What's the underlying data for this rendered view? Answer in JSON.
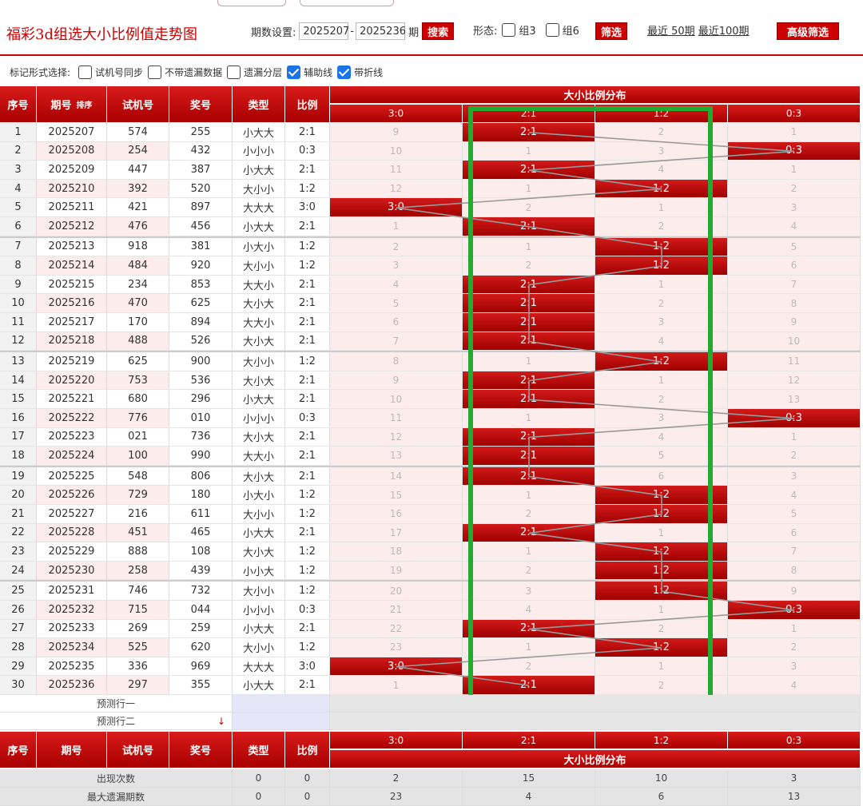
{
  "title": "福彩3d组选大小比例值走势图",
  "controls": {
    "period_label": "期数设置:",
    "from_period": "2025207",
    "dash": "-",
    "to_period": "2025236",
    "period_unit": "期",
    "search_label": "搜索",
    "shape_label": "形态:",
    "group3_label": "组3",
    "group6_label": "组6",
    "filter_label": "筛选",
    "recent50_label": "最近 50期",
    "recent100_label": "最近100期",
    "advanced_label": "高级筛选"
  },
  "markbar": {
    "label": "标记形式选择:",
    "opt1": "试机号同步",
    "opt2": "不带遗漏数据",
    "opt3": "遗漏分层",
    "opt4": "辅助线",
    "opt5": "带折线"
  },
  "headers": {
    "seq": "序号",
    "period": "期号",
    "sort": "排序",
    "trial": "试机号",
    "prize": "奖号",
    "type": "类型",
    "ratio": "比例",
    "dist": "大小比例分布",
    "cols": [
      "3:0",
      "2:1",
      "1:2",
      "0:3"
    ]
  },
  "rows": [
    {
      "seq": "1",
      "period": "2025207",
      "trial": "574",
      "prize": "255",
      "type": "小大大",
      "ratio": "2:1",
      "cells": [
        "9",
        "2:1",
        "2",
        "1"
      ],
      "hit": 1
    },
    {
      "seq": "2",
      "period": "2025208",
      "trial": "254",
      "prize": "432",
      "type": "小小小",
      "ratio": "0:3",
      "cells": [
        "10",
        "1",
        "3",
        "0:3"
      ],
      "hit": 3
    },
    {
      "seq": "3",
      "period": "2025209",
      "trial": "447",
      "prize": "387",
      "type": "小大大",
      "ratio": "2:1",
      "cells": [
        "11",
        "2:1",
        "4",
        "1"
      ],
      "hit": 1
    },
    {
      "seq": "4",
      "period": "2025210",
      "trial": "392",
      "prize": "520",
      "type": "大小小",
      "ratio": "1:2",
      "cells": [
        "12",
        "1",
        "1:2",
        "2"
      ],
      "hit": 2
    },
    {
      "seq": "5",
      "period": "2025211",
      "trial": "421",
      "prize": "897",
      "type": "大大大",
      "ratio": "3:0",
      "cells": [
        "3:0",
        "2",
        "1",
        "3"
      ],
      "hit": 0
    },
    {
      "seq": "6",
      "period": "2025212",
      "trial": "476",
      "prize": "456",
      "type": "小大大",
      "ratio": "2:1",
      "cells": [
        "1",
        "2:1",
        "2",
        "4"
      ],
      "hit": 1
    },
    {
      "seq": "7",
      "period": "2025213",
      "trial": "918",
      "prize": "381",
      "type": "小大小",
      "ratio": "1:2",
      "cells": [
        "2",
        "1",
        "1:2",
        "5"
      ],
      "hit": 2
    },
    {
      "seq": "8",
      "period": "2025214",
      "trial": "484",
      "prize": "920",
      "type": "大小小",
      "ratio": "1:2",
      "cells": [
        "3",
        "2",
        "1:2",
        "6"
      ],
      "hit": 2
    },
    {
      "seq": "9",
      "period": "2025215",
      "trial": "234",
      "prize": "853",
      "type": "大大小",
      "ratio": "2:1",
      "cells": [
        "4",
        "2:1",
        "1",
        "7"
      ],
      "hit": 1
    },
    {
      "seq": "10",
      "period": "2025216",
      "trial": "470",
      "prize": "625",
      "type": "大小大",
      "ratio": "2:1",
      "cells": [
        "5",
        "2:1",
        "2",
        "8"
      ],
      "hit": 1
    },
    {
      "seq": "11",
      "period": "2025217",
      "trial": "170",
      "prize": "894",
      "type": "大大小",
      "ratio": "2:1",
      "cells": [
        "6",
        "2:1",
        "3",
        "9"
      ],
      "hit": 1
    },
    {
      "seq": "12",
      "period": "2025218",
      "trial": "488",
      "prize": "526",
      "type": "大小大",
      "ratio": "2:1",
      "cells": [
        "7",
        "2:1",
        "4",
        "10"
      ],
      "hit": 1
    },
    {
      "seq": "13",
      "period": "2025219",
      "trial": "625",
      "prize": "900",
      "type": "大小小",
      "ratio": "1:2",
      "cells": [
        "8",
        "1",
        "1:2",
        "11"
      ],
      "hit": 2
    },
    {
      "seq": "14",
      "period": "2025220",
      "trial": "753",
      "prize": "536",
      "type": "大小大",
      "ratio": "2:1",
      "cells": [
        "9",
        "2:1",
        "1",
        "12"
      ],
      "hit": 1
    },
    {
      "seq": "15",
      "period": "2025221",
      "trial": "680",
      "prize": "296",
      "type": "小大大",
      "ratio": "2:1",
      "cells": [
        "10",
        "2:1",
        "2",
        "13"
      ],
      "hit": 1
    },
    {
      "seq": "16",
      "period": "2025222",
      "trial": "776",
      "prize": "010",
      "type": "小小小",
      "ratio": "0:3",
      "cells": [
        "11",
        "1",
        "3",
        "0:3"
      ],
      "hit": 3
    },
    {
      "seq": "17",
      "period": "2025223",
      "trial": "021",
      "prize": "736",
      "type": "大小大",
      "ratio": "2:1",
      "cells": [
        "12",
        "2:1",
        "4",
        "1"
      ],
      "hit": 1
    },
    {
      "seq": "18",
      "period": "2025224",
      "trial": "100",
      "prize": "990",
      "type": "大大小",
      "ratio": "2:1",
      "cells": [
        "13",
        "2:1",
        "5",
        "2"
      ],
      "hit": 1
    },
    {
      "seq": "19",
      "period": "2025225",
      "trial": "548",
      "prize": "806",
      "type": "大小大",
      "ratio": "2:1",
      "cells": [
        "14",
        "2:1",
        "6",
        "3"
      ],
      "hit": 1
    },
    {
      "seq": "20",
      "period": "2025226",
      "trial": "729",
      "prize": "180",
      "type": "小大小",
      "ratio": "1:2",
      "cells": [
        "15",
        "1",
        "1:2",
        "4"
      ],
      "hit": 2
    },
    {
      "seq": "21",
      "period": "2025227",
      "trial": "216",
      "prize": "611",
      "type": "大小小",
      "ratio": "1:2",
      "cells": [
        "16",
        "2",
        "1:2",
        "5"
      ],
      "hit": 2
    },
    {
      "seq": "22",
      "period": "2025228",
      "trial": "451",
      "prize": "465",
      "type": "小大大",
      "ratio": "2:1",
      "cells": [
        "17",
        "2:1",
        "1",
        "6"
      ],
      "hit": 1
    },
    {
      "seq": "23",
      "period": "2025229",
      "trial": "888",
      "prize": "108",
      "type": "大小大",
      "ratio": "1:2",
      "cells": [
        "18",
        "1",
        "1:2",
        "7"
      ],
      "hit": 2
    },
    {
      "seq": "24",
      "period": "2025230",
      "trial": "258",
      "prize": "439",
      "type": "小小大",
      "ratio": "1:2",
      "cells": [
        "19",
        "2",
        "1:2",
        "8"
      ],
      "hit": 2
    },
    {
      "seq": "25",
      "period": "2025231",
      "trial": "746",
      "prize": "732",
      "type": "大小小",
      "ratio": "1:2",
      "cells": [
        "20",
        "3",
        "1:2",
        "9"
      ],
      "hit": 2
    },
    {
      "seq": "26",
      "period": "2025232",
      "trial": "715",
      "prize": "044",
      "type": "小小小",
      "ratio": "0:3",
      "cells": [
        "21",
        "4",
        "1",
        "0:3"
      ],
      "hit": 3
    },
    {
      "seq": "27",
      "period": "2025233",
      "trial": "269",
      "prize": "259",
      "type": "小大大",
      "ratio": "2:1",
      "cells": [
        "22",
        "2:1",
        "2",
        "1"
      ],
      "hit": 1
    },
    {
      "seq": "28",
      "period": "2025234",
      "trial": "525",
      "prize": "620",
      "type": "大小小",
      "ratio": "1:2",
      "cells": [
        "23",
        "1",
        "1:2",
        "2"
      ],
      "hit": 2
    },
    {
      "seq": "29",
      "period": "2025235",
      "trial": "336",
      "prize": "969",
      "type": "大大大",
      "ratio": "3:0",
      "cells": [
        "3:0",
        "2",
        "1",
        "3"
      ],
      "hit": 0
    },
    {
      "seq": "30",
      "period": "2025236",
      "trial": "297",
      "prize": "355",
      "type": "小大大",
      "ratio": "2:1",
      "cells": [
        "1",
        "2:1",
        "2",
        "4"
      ],
      "hit": 1
    }
  ],
  "predict": {
    "row1": "预测行一",
    "row2": "预测行二"
  },
  "footer": {
    "count_label": "出现次数",
    "count_vals": [
      "0",
      "0",
      "2",
      "15",
      "10",
      "3"
    ],
    "maxmiss_label": "最大遗漏期数",
    "maxmiss_vals": [
      "0",
      "0",
      "23",
      "4",
      "6",
      "13"
    ]
  },
  "colors": {
    "accent": "#cc0000",
    "highlight_box": "#22aa33",
    "link_line": "#999999"
  }
}
